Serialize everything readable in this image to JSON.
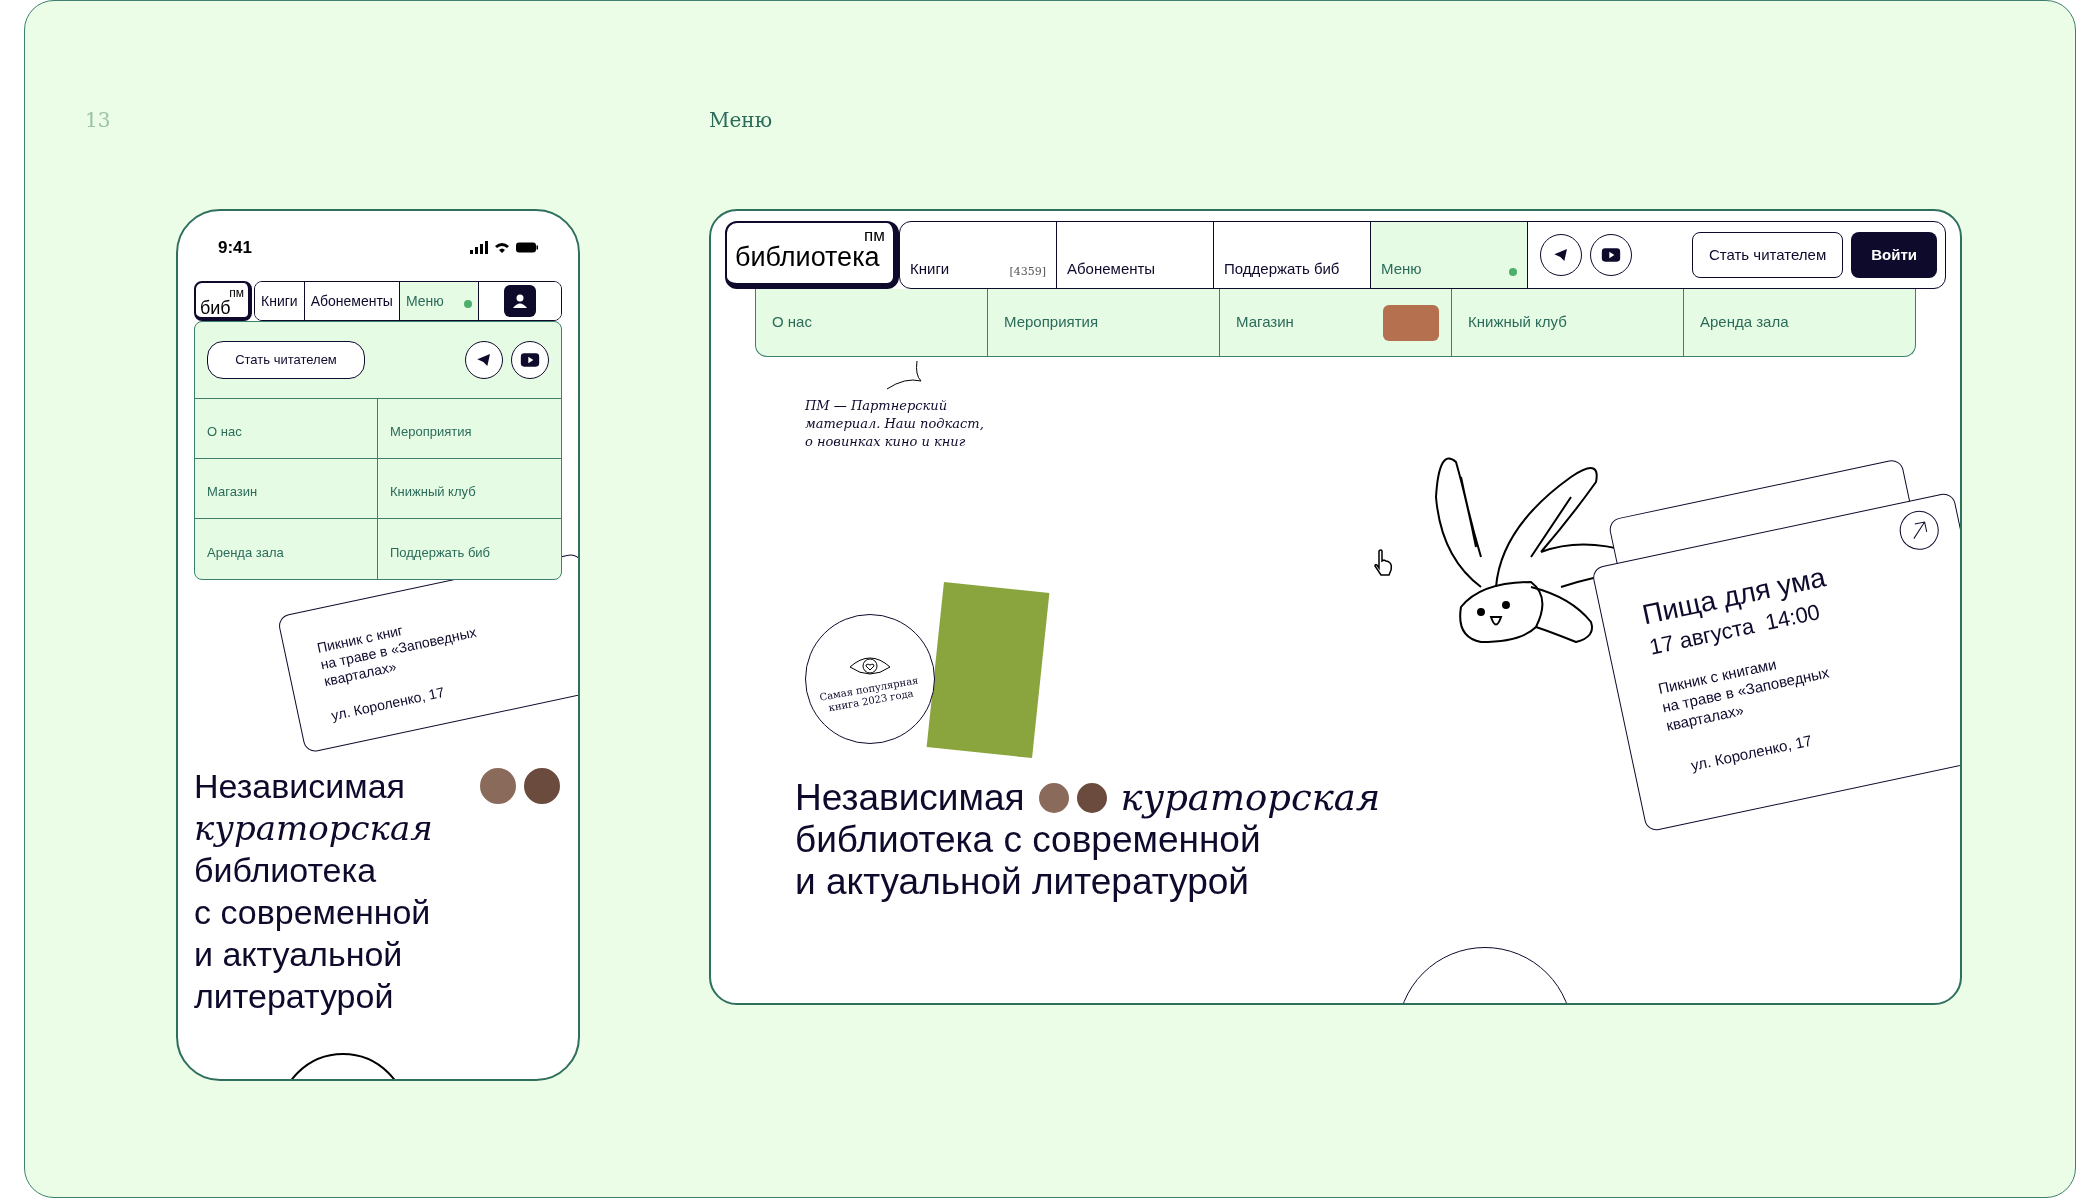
{
  "slide": {
    "page_number": "13",
    "title": "Меню"
  },
  "phone": {
    "status_time": "9:41",
    "logo": {
      "top": "пм",
      "bottom": "биб"
    },
    "nav": [
      {
        "label": "Книги",
        "selected": false
      },
      {
        "label": "Абонементы",
        "selected": false
      },
      {
        "label": "Меню",
        "selected": true
      }
    ],
    "cta": "Стать читателем",
    "menu_items": [
      "О нас",
      "Мероприятия",
      "Магазин",
      "Книжный клуб",
      "Аренда зала",
      "Поддержать биб"
    ],
    "event_lines": [
      "Пикник с книг",
      "на траве в «Заповедных",
      "кварталах»",
      "ул. Короленко, 17"
    ],
    "headline": [
      {
        "text": "Независимая",
        "kind": "plain"
      },
      {
        "text": "кураторская",
        "kind": "accent"
      },
      {
        "text": "библиотека",
        "kind": "plain"
      },
      {
        "text": "с современной",
        "kind": "plain"
      },
      {
        "text": "и актуальной",
        "kind": "plain"
      },
      {
        "text": "литературой",
        "kind": "plain"
      }
    ]
  },
  "desktop": {
    "logo": {
      "top": "пм",
      "bottom": "библиотека"
    },
    "nav": [
      {
        "label": "Книги",
        "count": "[4359]",
        "selected": false
      },
      {
        "label": "Абонементы",
        "selected": false
      },
      {
        "label": "Поддержать биб",
        "selected": false
      },
      {
        "label": "Меню",
        "selected": true
      }
    ],
    "cta": "Стать читателем",
    "login": "Войти",
    "submenu": [
      {
        "label": "О нас",
        "hovered": false
      },
      {
        "label": "Мероприятия",
        "hovered": false
      },
      {
        "label": "Магазин",
        "hovered": true
      },
      {
        "label": "Книжный клуб",
        "hovered": false
      },
      {
        "label": "Аренда зала",
        "hovered": false
      }
    ],
    "note": [
      "ПМ — Партнерский",
      "материал. Наш подкаст,",
      "о новинках кино и книг"
    ],
    "badge": "Самая популярная книга 2023 года",
    "headline": [
      {
        "text": "Независимая",
        "kind": "plain"
      },
      {
        "text": "кураторская",
        "kind": "accent"
      },
      {
        "text": "библиотека с современной",
        "kind": "plain"
      },
      {
        "text": "и актуальной литературой",
        "kind": "plain"
      }
    ],
    "event": {
      "title": "Пища для ума",
      "date": "17 августа  14:00",
      "description": [
        "Пикник с книгами",
        "на траве в «Заповедных",
        "кварталах»"
      ],
      "address": "ул. Короленко, 17"
    }
  }
}
